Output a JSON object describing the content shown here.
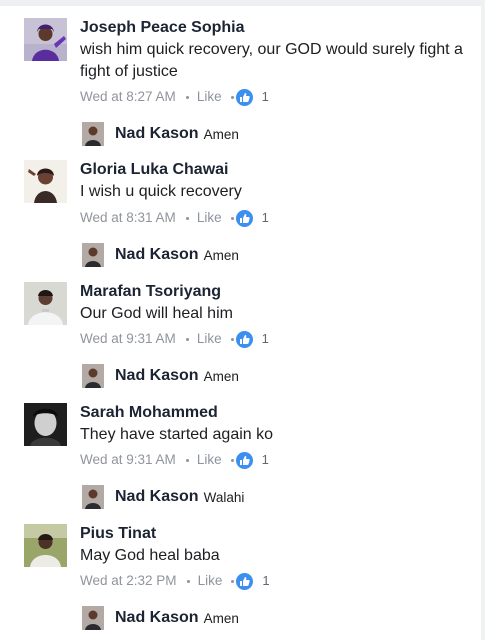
{
  "comments": [
    {
      "name": "Joseph Peace Sophia",
      "text": "wish him quick recovery, our GOD would surely fight a fight of justice",
      "time": "Wed at 8:27 AM",
      "like_label": "Like",
      "like_count": "1",
      "avatar": "avatar-photo-purple-outfit",
      "reply": {
        "name": "Nad Kason",
        "text": "Amen",
        "avatar": "avatar-photo-man"
      }
    },
    {
      "name": "Gloria Luka Chawai",
      "text": "I wish u  quick recovery",
      "time": "Wed at 8:31 AM",
      "like_label": "Like",
      "like_count": "1",
      "avatar": "avatar-photo-woman",
      "reply": {
        "name": "Nad Kason",
        "text": "Amen",
        "avatar": "avatar-photo-man"
      }
    },
    {
      "name": "Marafan Tsoriyang",
      "text": "Our God will heal him",
      "time": "Wed at 9:31 AM",
      "like_label": "Like",
      "like_count": "1",
      "avatar": "avatar-photo-man-white-shirt",
      "reply": {
        "name": "Nad Kason",
        "text": "Amen",
        "avatar": "avatar-photo-man"
      }
    },
    {
      "name": "Sarah Mohammed",
      "text": "They have started again  ko",
      "time": "Wed at 9:31 AM",
      "like_label": "Like",
      "like_count": "1",
      "avatar": "avatar-photo-dark-portrait",
      "reply": {
        "name": "Nad Kason",
        "text": "Walahi",
        "avatar": "avatar-photo-man"
      }
    },
    {
      "name": "Pius Tinat",
      "text": "May God heal baba",
      "time": "Wed at 2:32 PM",
      "like_label": "Like",
      "like_count": "1",
      "avatar": "avatar-photo-man-outdoor",
      "reply": {
        "name": "Nad Kason",
        "text": "Amen",
        "avatar": "avatar-photo-man"
      }
    }
  ],
  "colors": {
    "name": "#1c2433",
    "meta": "#90949c",
    "like_badge": "#3b8ff0"
  }
}
